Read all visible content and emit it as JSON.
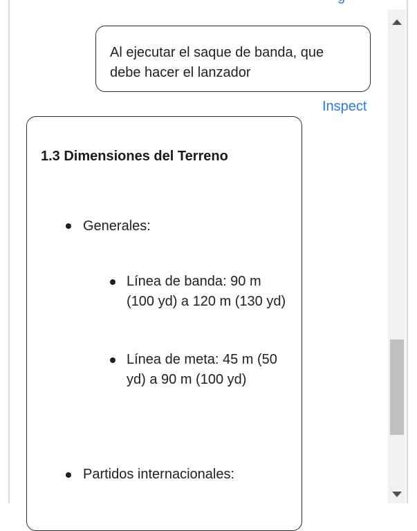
{
  "top_link_fragment": "g",
  "user_message": {
    "text": "Al ejecutar el saque de banda, que debe hacer el lanzador"
  },
  "inspect_label": "Inspect",
  "assistant_message": {
    "section_title": "1.3 Dimensiones del Terreno",
    "items": [
      {
        "label": "Generales:",
        "subitems": [
          "Línea de banda: 90 m (100 yd) a 120 m (130 yd)",
          "Línea de meta: 45 m (50 yd) a 90 m (100 yd)"
        ]
      },
      {
        "label": "Partidos internacionales:"
      }
    ]
  },
  "colors": {
    "link": "#2b7bd6",
    "border": "#2b2b2b",
    "text": "#1f1f1f",
    "scroll_thumb": "#c1c1c1"
  }
}
